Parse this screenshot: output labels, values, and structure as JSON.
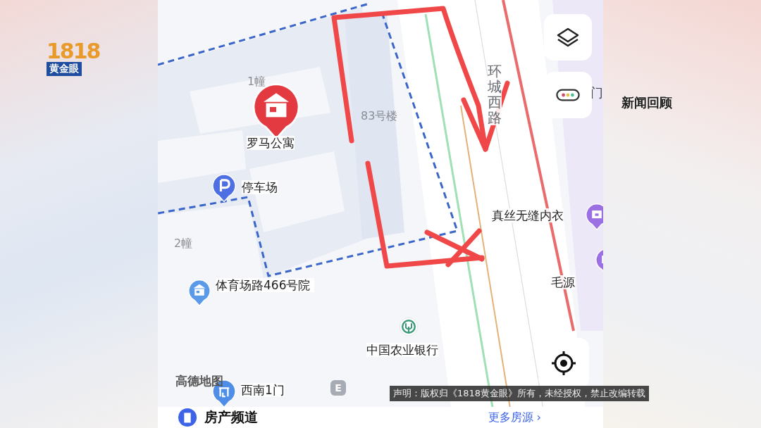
{
  "map": {
    "building_labels": [
      "1幢",
      "83号楼",
      "2幢"
    ],
    "road_label": "环城西路",
    "pois": [
      {
        "kind": "apartment",
        "label": "罗马公寓"
      },
      {
        "kind": "parking",
        "label": "停车场"
      },
      {
        "kind": "community",
        "label": "体育场路466号院"
      },
      {
        "kind": "bank",
        "label": "中国农业银行"
      },
      {
        "kind": "shop",
        "label": "真丝无缝内衣"
      },
      {
        "kind": "shop",
        "label": "毛源"
      },
      {
        "kind": "gate",
        "label": "西南1门"
      }
    ],
    "edge_label": "门",
    "map_logo": "高德地图",
    "entrance_badge": "E"
  },
  "bottom_sheet": {
    "title": "房产频道",
    "link": "更多房源 ›"
  },
  "broadcast_overlay": {
    "logo_number": "1818",
    "logo_name": "黄金眼",
    "section": "新闻回顾",
    "disclaimer": "声明：版权归《1818黄金眼》所有，未经授权，禁止改编转载"
  }
}
